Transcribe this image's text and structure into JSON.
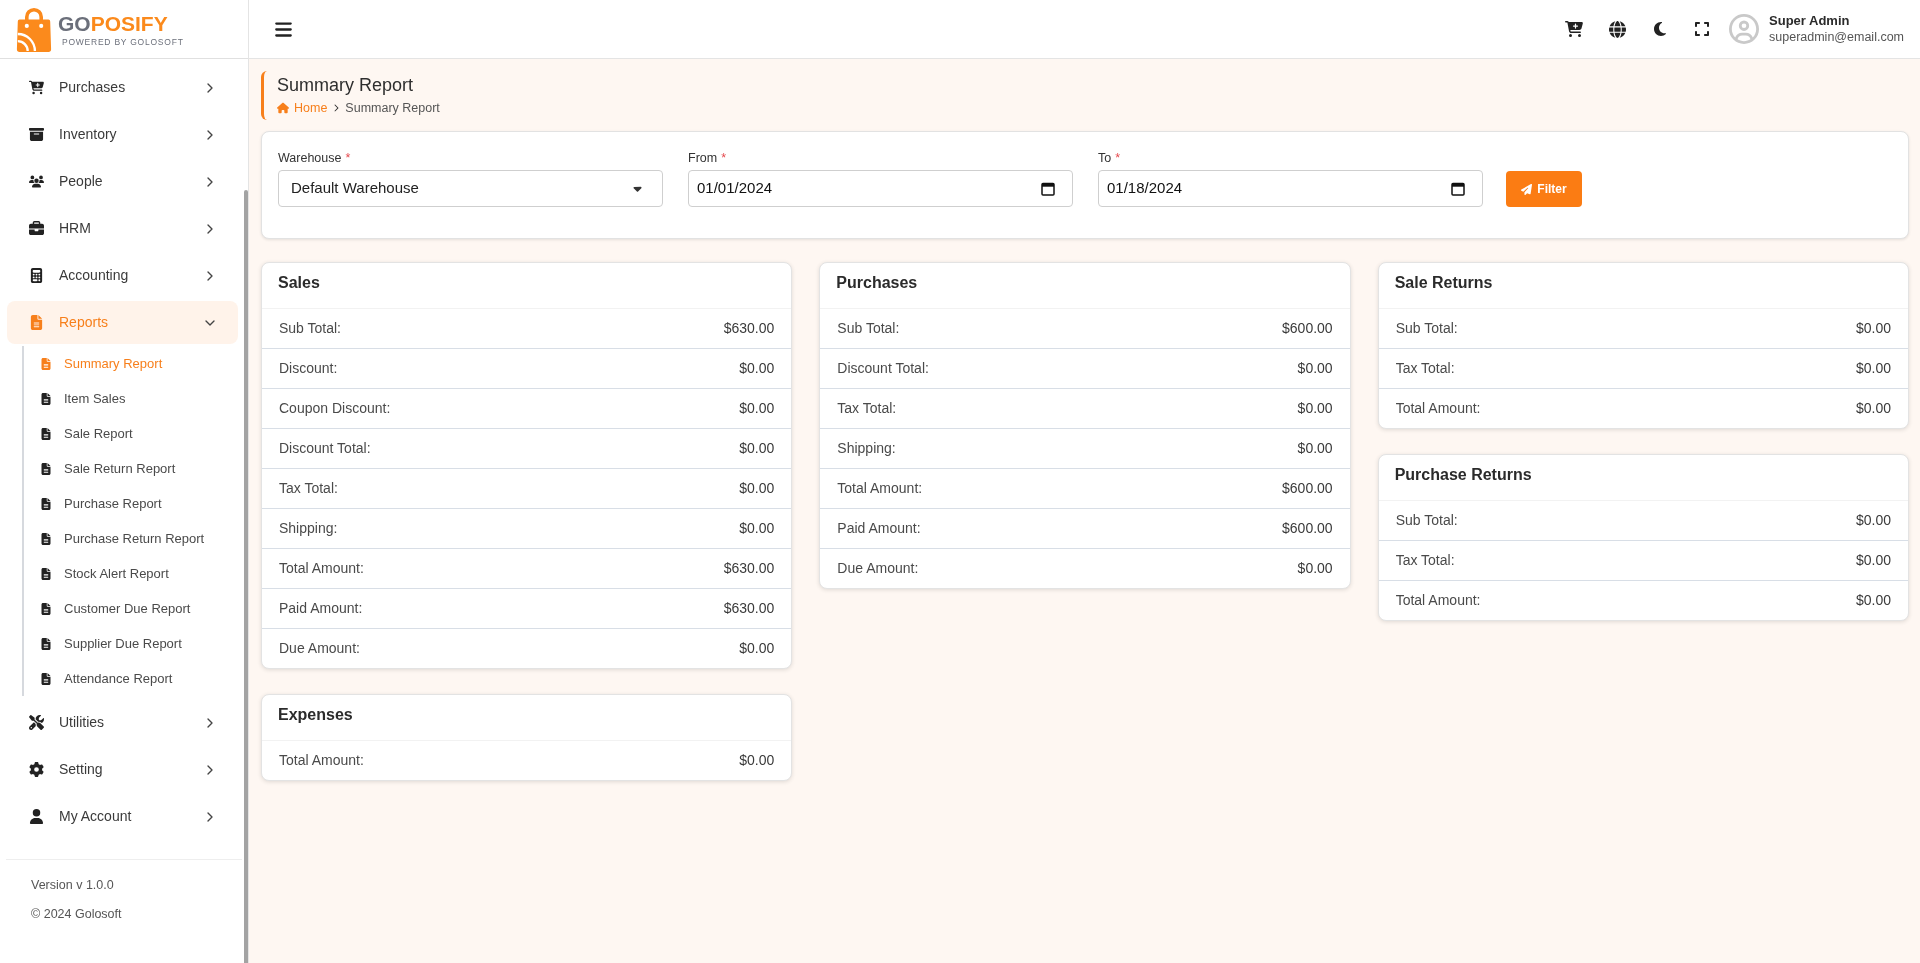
{
  "sidebar": {
    "logo": {
      "brand_start": "GO",
      "brand_end": "POSIFY",
      "tagline": "POWERED BY GOLOSOFT"
    },
    "menu": [
      {
        "label": "Purchases",
        "selected": false,
        "expanded": false
      },
      {
        "label": "Inventory",
        "selected": false,
        "expanded": false
      },
      {
        "label": "People",
        "selected": false,
        "expanded": false
      },
      {
        "label": "HRM",
        "selected": false,
        "expanded": false
      },
      {
        "label": "Accounting",
        "selected": false,
        "expanded": false
      },
      {
        "label": "Reports",
        "selected": true,
        "expanded": true,
        "children": [
          {
            "label": "Summary Report",
            "selected": true
          },
          {
            "label": "Item Sales",
            "selected": false
          },
          {
            "label": "Sale Report",
            "selected": false
          },
          {
            "label": "Sale Return Report",
            "selected": false
          },
          {
            "label": "Purchase Report",
            "selected": false
          },
          {
            "label": "Purchase Return Report",
            "selected": false
          },
          {
            "label": "Stock Alert Report",
            "selected": false
          },
          {
            "label": "Customer Due Report",
            "selected": false
          },
          {
            "label": "Supplier Due Report",
            "selected": false
          },
          {
            "label": "Attendance Report",
            "selected": false
          }
        ]
      },
      {
        "label": "Utilities",
        "selected": false,
        "expanded": false
      },
      {
        "label": "Setting",
        "selected": false,
        "expanded": false
      },
      {
        "label": "My Account",
        "selected": false,
        "expanded": false
      }
    ],
    "footer": {
      "version": "Version v 1.0.0",
      "copyright": "© 2024 Golosoft"
    }
  },
  "header": {
    "user": {
      "name": "Super Admin",
      "email": "superadmin@email.com"
    }
  },
  "page_header": {
    "title": "Summary Report",
    "breadcrumb": [
      {
        "label": "Home",
        "kind": "link"
      },
      {
        "label": "Summary Report",
        "kind": "current"
      }
    ]
  },
  "filter": {
    "fields": [
      {
        "label": "Warehouse",
        "required_mark": "*",
        "kind": "select",
        "value": "Default Warehouse"
      },
      {
        "label": "From",
        "required_mark": "*",
        "kind": "date",
        "value": "01/01/2024"
      },
      {
        "label": "To",
        "required_mark": "*",
        "kind": "date",
        "value": "01/18/2024"
      }
    ],
    "button": "Filter"
  },
  "report_columns": [
    {
      "cards": [
        {
          "title": "Sales",
          "rows": [
            {
              "label": "Sub Total:",
              "value": "$630.00"
            },
            {
              "label": "Discount:",
              "value": "$0.00"
            },
            {
              "label": "Coupon Discount:",
              "value": "$0.00"
            },
            {
              "label": "Discount Total:",
              "value": "$0.00"
            },
            {
              "label": "Tax Total:",
              "value": "$0.00"
            },
            {
              "label": "Shipping:",
              "value": "$0.00"
            },
            {
              "label": "Total Amount:",
              "value": "$630.00"
            },
            {
              "label": "Paid Amount:",
              "value": "$630.00"
            },
            {
              "label": "Due Amount:",
              "value": "$0.00"
            }
          ]
        },
        {
          "title": "Expenses",
          "rows": [
            {
              "label": "Total Amount:",
              "value": "$0.00"
            }
          ]
        }
      ]
    },
    {
      "cards": [
        {
          "title": "Purchases",
          "rows": [
            {
              "label": "Sub Total:",
              "value": "$600.00"
            },
            {
              "label": "Discount Total:",
              "value": "$0.00"
            },
            {
              "label": "Tax Total:",
              "value": "$0.00"
            },
            {
              "label": "Shipping:",
              "value": "$0.00"
            },
            {
              "label": "Total Amount:",
              "value": "$600.00"
            },
            {
              "label": "Paid Amount:",
              "value": "$600.00"
            },
            {
              "label": "Due Amount:",
              "value": "$0.00"
            }
          ]
        }
      ]
    },
    {
      "cards": [
        {
          "title": "Sale Returns",
          "rows": [
            {
              "label": "Sub Total:",
              "value": "$0.00"
            },
            {
              "label": "Tax Total:",
              "value": "$0.00"
            },
            {
              "label": "Total Amount:",
              "value": "$0.00"
            }
          ]
        },
        {
          "title": "Purchase Returns",
          "rows": [
            {
              "label": "Sub Total:",
              "value": "$0.00"
            },
            {
              "label": "Tax Total:",
              "value": "$0.00"
            },
            {
              "label": "Total Amount:",
              "value": "$0.00"
            }
          ]
        }
      ]
    }
  ]
}
